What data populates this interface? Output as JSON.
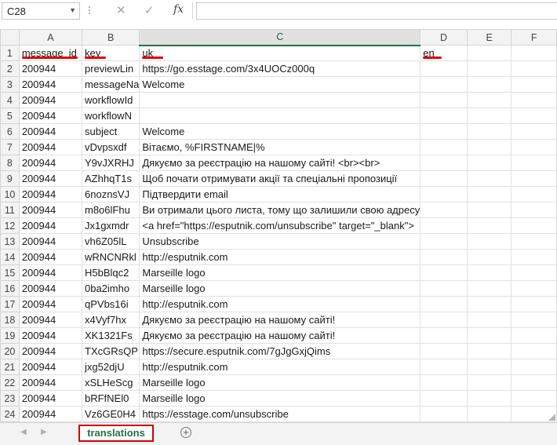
{
  "formula_bar": {
    "name_box": "C28",
    "cancel_icon": "✕",
    "enter_icon": "✓",
    "fx_label": "fx",
    "formula_value": ""
  },
  "columns": [
    "A",
    "B",
    "C",
    "D",
    "E",
    "F"
  ],
  "selected_column": "C",
  "rows": [
    {
      "num": "1",
      "a": "message_id",
      "b": "key",
      "c": "uk",
      "d": "en"
    },
    {
      "num": "2",
      "a": "200944",
      "b": "previewLin",
      "c": "https://go.esstage.com/3x4UOCz000q",
      "d": ""
    },
    {
      "num": "3",
      "a": "200944",
      "b": "messageNa",
      "c": "Welcome",
      "d": ""
    },
    {
      "num": "4",
      "a": "200944",
      "b": "workflowId",
      "c": "",
      "d": ""
    },
    {
      "num": "5",
      "a": "200944",
      "b": "workflowN",
      "c": "",
      "d": ""
    },
    {
      "num": "6",
      "a": "200944",
      "b": "subject",
      "c": "Welcome",
      "d": ""
    },
    {
      "num": "7",
      "a": "200944",
      "b": "vDvpsxdf",
      "c": "Вітаємо, %FIRSTNAME|%",
      "d": ""
    },
    {
      "num": "8",
      "a": "200944",
      "b": "Y9vJXRHJ",
      "c": "Дякуємо за реєстрацію на нашому сайті! <br><br>",
      "d": ""
    },
    {
      "num": "9",
      "a": "200944",
      "b": "AZhhqT1s",
      "c": "Щоб почати отримувати акції та спеціальні пропозиції",
      "d": ""
    },
    {
      "num": "10",
      "a": "200944",
      "b": "6noznsVJ",
      "c": " Підтвердити email",
      "d": ""
    },
    {
      "num": "11",
      "a": "200944",
      "b": "m8o6lFhu",
      "c": "Ви отримали цього листа, тому що залишили свою адресу",
      "d": ""
    },
    {
      "num": "12",
      "a": "200944",
      "b": "Jx1gxmdr",
      "c": "<a href=\"https://esputnik.com/unsubscribe\" target=\"_blank\">",
      "d": ""
    },
    {
      "num": "13",
      "a": "200944",
      "b": "vh6Z05lL",
      "c": "Unsubscribe",
      "d": ""
    },
    {
      "num": "14",
      "a": "200944",
      "b": "wRNCNRkl",
      "c": "http://esputnik.com",
      "d": ""
    },
    {
      "num": "15",
      "a": "200944",
      "b": "H5bBlqc2",
      "c": "Marseille logo",
      "d": ""
    },
    {
      "num": "16",
      "a": "200944",
      "b": "0ba2imho",
      "c": "Marseille logo",
      "d": ""
    },
    {
      "num": "17",
      "a": "200944",
      "b": "qPVbs16i",
      "c": "http://esputnik.com",
      "d": ""
    },
    {
      "num": "18",
      "a": "200944",
      "b": "x4Vyf7hx",
      "c": "Дякуємо за реєстрацію на нашому сайті!",
      "d": ""
    },
    {
      "num": "19",
      "a": "200944",
      "b": "XK1321Fs",
      "c": "Дякуємо за реєстрацію на нашому сайті!",
      "d": ""
    },
    {
      "num": "20",
      "a": "200944",
      "b": "TXcGRsQP",
      "c": "https://secure.esputnik.com/7gJgGxjQims",
      "d": ""
    },
    {
      "num": "21",
      "a": "200944",
      "b": "jxg52djU",
      "c": "http://esputnik.com",
      "d": ""
    },
    {
      "num": "22",
      "a": "200944",
      "b": "xSLHeScg",
      "c": "Marseille logo",
      "d": ""
    },
    {
      "num": "23",
      "a": "200944",
      "b": "bRFfNEl0",
      "c": "Marseille logo",
      "d": ""
    },
    {
      "num": "24",
      "a": "200944",
      "b": "Vz6GE0H4",
      "c": "https://esstage.com/unsubscribe",
      "d": ""
    }
  ],
  "sheet_tabs": [
    {
      "label": "translations",
      "active": true
    }
  ],
  "add_sheet_icon": "+",
  "colors": {
    "accent": "#217346",
    "highlight": "#e00000"
  }
}
